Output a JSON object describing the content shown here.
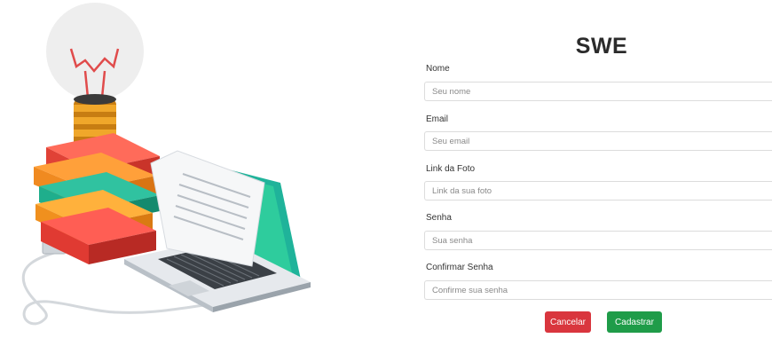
{
  "form": {
    "title": "SWE",
    "fields": [
      {
        "label": "Nome",
        "placeholder": "Seu nome"
      },
      {
        "label": "Email",
        "placeholder": "Seu email"
      },
      {
        "label": "Link da Foto",
        "placeholder": "Link da sua foto"
      },
      {
        "label": "Senha",
        "placeholder": "Sua senha"
      },
      {
        "label": "Confirmar Senha",
        "placeholder": "Confirme sua senha"
      }
    ],
    "cancel_label": "Cancelar",
    "submit_label": "Cadastrar"
  },
  "colors": {
    "cancel": "#d9363e",
    "submit": "#1f9c49",
    "text": "#2b2b2b"
  },
  "illustration": {
    "icons": [
      "lightbulb-icon",
      "books-icon",
      "laptop-icon",
      "document-icon",
      "cable-icon"
    ]
  }
}
